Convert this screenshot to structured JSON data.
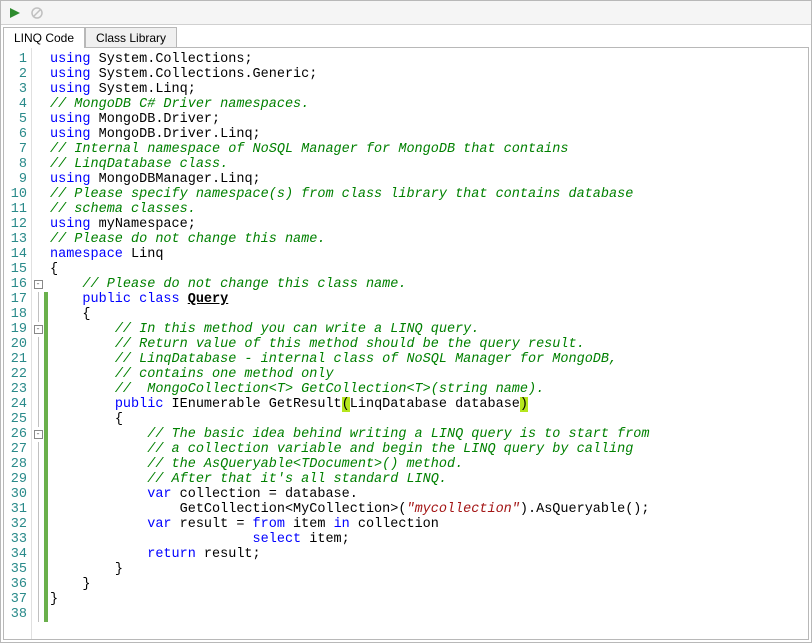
{
  "tabs": {
    "linq": "LINQ Code",
    "lib": "Class Library",
    "active": "linq"
  },
  "toolbar": {
    "run": "run-icon",
    "stop": "stop-icon"
  },
  "lineCount": 38,
  "code": {
    "l1": {
      "kw1": "using",
      "txt1": " System.Collections;"
    },
    "l2": {
      "kw1": "using",
      "txt1": " System.Collections.Generic;"
    },
    "l3": {
      "kw1": "using",
      "txt1": " System.Linq;"
    },
    "l4": {
      "com": "// MongoDB C# Driver namespaces."
    },
    "l5": {
      "kw1": "using",
      "txt1": " MongoDB.Driver;"
    },
    "l6": {
      "kw1": "using",
      "txt1": " MongoDB.Driver.Linq;"
    },
    "l7": {
      "com": "// Internal namespace of NoSQL Manager for MongoDB that contains"
    },
    "l8": {
      "com": "// LinqDatabase class."
    },
    "l9": {
      "kw1": "using",
      "txt1": " MongoDBManager.Linq;"
    },
    "l10": {
      "com": "// Please specify namespace(s) from class library that contains database"
    },
    "l11": {
      "com": "// schema classes."
    },
    "l12": {
      "kw1": "using",
      "txt1": " myNamespace;"
    },
    "l13": {
      "txt": ""
    },
    "l14": {
      "com": "// Please do not change this name."
    },
    "l15": {
      "kw1": "namespace",
      "txt1": " Linq"
    },
    "l16": {
      "txt": "{"
    },
    "l17": {
      "pad": "    ",
      "com": "// Please do not change this class name."
    },
    "l18": {
      "pad": "    ",
      "kw1": "public",
      "kw2": " class",
      "txt1": " ",
      "cls": "Query"
    },
    "l19": {
      "pad": "    ",
      "txt": "{ "
    },
    "l20": {
      "pad": "        ",
      "com": "// In this method you can write a LINQ query."
    },
    "l21": {
      "pad": "        ",
      "com": "// Return value of this method should be the query result."
    },
    "l22": {
      "pad": "        ",
      "com": "// LinqDatabase - internal class of NoSQL Manager for MongoDB,"
    },
    "l23": {
      "pad": "        ",
      "com": "// contains one method only"
    },
    "l24": {
      "pad": "        ",
      "com": "//  MongoCollection<T> GetCollection<T>(string name)."
    },
    "l25": {
      "pad": "        ",
      "kw1": "public",
      "txt1": " IEnumerable GetResult",
      "hl1": "(",
      "txt2": "LinqDatabase database",
      "hl2": ")"
    },
    "l26": {
      "pad": "        ",
      "txt": "{"
    },
    "l27": {
      "pad": "            ",
      "com": "// The basic idea behind writing a LINQ query is to start from"
    },
    "l28": {
      "pad": "            ",
      "com": "// a collection variable and begin the LINQ query by calling"
    },
    "l29": {
      "pad": "            ",
      "com": "// the AsQueryable<TDocument>() method."
    },
    "l30": {
      "pad": "            ",
      "com": "// After that it's all standard LINQ."
    },
    "l31": {
      "pad": "            ",
      "kw1": "var",
      "txt1": " collection = database."
    },
    "l32": {
      "pad": "                ",
      "txt1": "GetCollection<MyCollection>(",
      "str": "\"mycollection\"",
      "txt2": ").AsQueryable();"
    },
    "l33": {
      "pad": "            ",
      "kw1": "var",
      "txt1": " result = ",
      "kw2": "from",
      "txt2": " item ",
      "kw3": "in",
      "txt3": " collection"
    },
    "l34": {
      "pad": "                         ",
      "kw1": "select",
      "txt1": " item;"
    },
    "l35": {
      "pad": "            ",
      "kw1": "return",
      "txt1": " result;"
    },
    "l36": {
      "pad": "        ",
      "txt": "}"
    },
    "l37": {
      "pad": "    ",
      "txt": "}"
    },
    "l38": {
      "txt": "}"
    }
  }
}
